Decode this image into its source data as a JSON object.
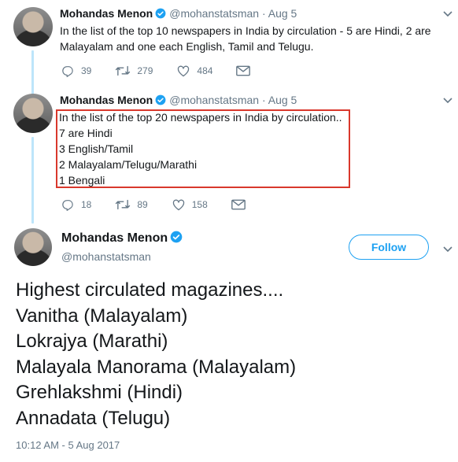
{
  "tweet1": {
    "name": "Mohandas Menon",
    "handle": "@mohanstatsman",
    "separator": "·",
    "date": "Aug 5",
    "text_line1": "In the list of the top 10 newspapers in India by circulation - 5 are Hindi, 2 are",
    "text_line2": "Malayalam and one each English, Tamil and Telugu.",
    "replies": "39",
    "retweets": "279",
    "likes": "484"
  },
  "tweet2": {
    "name": "Mohandas Menon",
    "handle": "@mohanstatsman",
    "separator": "·",
    "date": "Aug 5",
    "lines": [
      "In the list of the top 20 newspapers in India by circulation..",
      "7 are Hindi",
      "3 English/Tamil",
      "2 Malayalam/Telugu/Marathi",
      "1 Bengali"
    ],
    "replies": "18",
    "retweets": "89",
    "likes": "158"
  },
  "tweet3": {
    "name": "Mohandas Menon",
    "handle": "@mohanstatsman",
    "follow_label": "Follow",
    "lines": [
      "Highest circulated magazines....",
      "Vanitha (Malayalam)",
      "Lokrajya (Marathi)",
      "Malayala Manorama (Malayalam)",
      "Grehlakshmi (Hindi)",
      "Annadata  (Telugu)"
    ],
    "timestamp": "10:12 AM - 5 Aug 2017"
  },
  "colors": {
    "accent": "#1da1f2",
    "muted": "#657786",
    "highlight_border": "#d9382c",
    "thread_line": "#bde5fa"
  }
}
